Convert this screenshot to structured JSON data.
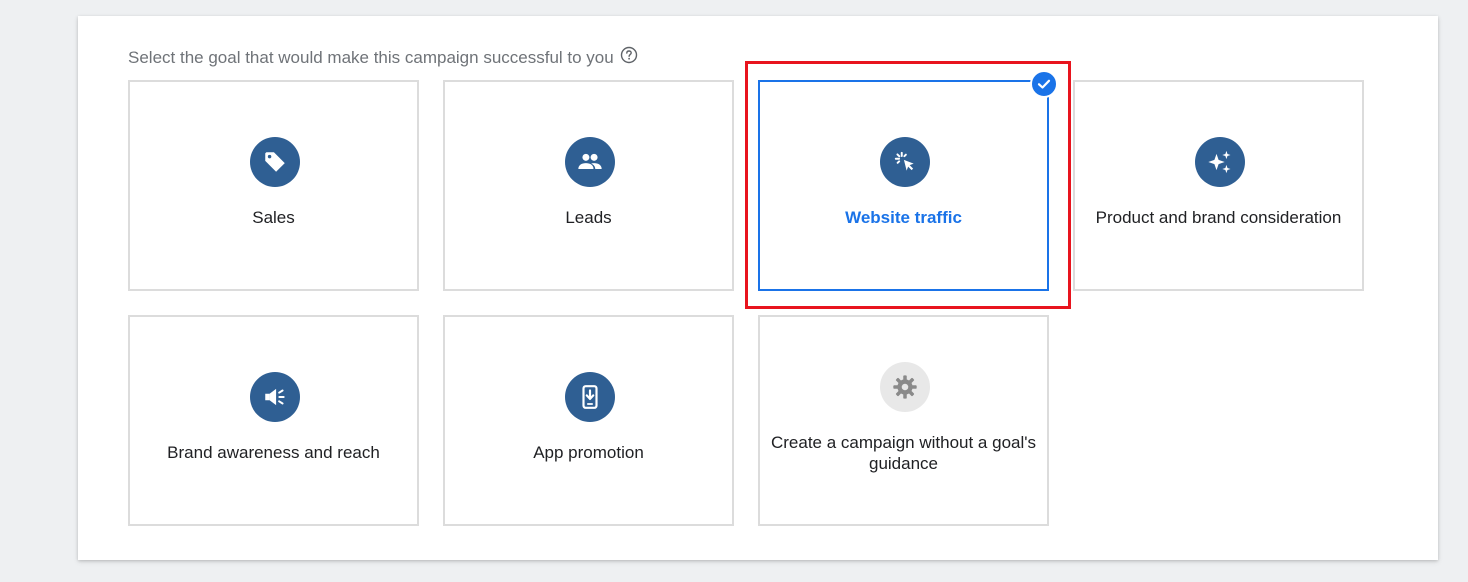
{
  "prompt": {
    "text": "Select the goal that would make this campaign successful to you",
    "help_icon": "help-circle-icon"
  },
  "goals": [
    {
      "label": "Sales",
      "icon": "tag-icon",
      "selected": false
    },
    {
      "label": "Leads",
      "icon": "people-icon",
      "selected": false
    },
    {
      "label": "Website traffic",
      "icon": "cursor-click-icon",
      "selected": true
    },
    {
      "label": "Product and brand consideration",
      "icon": "sparkles-icon",
      "selected": false
    },
    {
      "label": "Brand awareness and reach",
      "icon": "megaphone-icon",
      "selected": false
    },
    {
      "label": "App promotion",
      "icon": "phone-download-icon",
      "selected": false
    },
    {
      "label": "Create a campaign without a goal's guidance",
      "icon": "gear-icon",
      "selected": false
    }
  ],
  "colors": {
    "icon_background": "#2f5f93",
    "selected_accent": "#1a73e8",
    "highlight": "#e8141e",
    "card_border": "#dcdcdc"
  }
}
